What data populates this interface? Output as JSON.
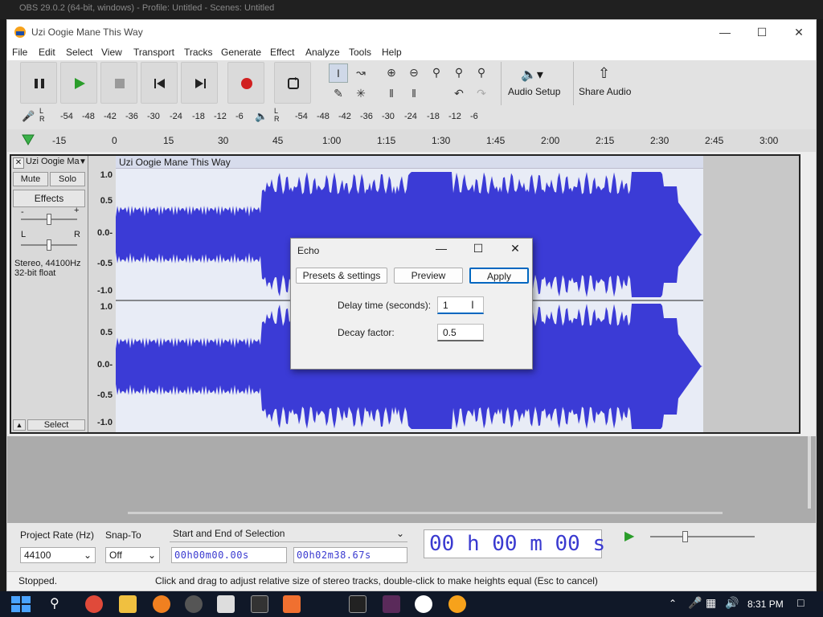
{
  "background_window": {
    "title": "OBS 29.0.2 (64-bit, windows) - Profile: Untitled - Scenes: Untitled"
  },
  "app": {
    "title": "Uzi Oogie Mane This Way",
    "menu": [
      "File",
      "Edit",
      "Select",
      "View",
      "Transport",
      "Tracks",
      "Generate",
      "Effect",
      "Analyze",
      "Tools",
      "Help"
    ],
    "audio_setup_label": "Audio Setup",
    "share_audio_label": "Share Audio",
    "meter_labels": [
      "-54",
      "-48",
      "-42",
      "-36",
      "-30",
      "-24",
      "-18",
      "-12",
      "-6"
    ],
    "timeline_ticks": [
      "-15",
      "0",
      "15",
      "30",
      "45",
      "1:00",
      "1:15",
      "1:30",
      "1:45",
      "2:00",
      "2:15",
      "2:30",
      "2:45",
      "3:00"
    ],
    "track": {
      "name": "Uzi Oogie Mane This Way",
      "short_name": "Uzi Oogie Ma",
      "mute_label": "Mute",
      "solo_label": "Solo",
      "effects_label": "Effects",
      "info_line1": "Stereo, 44100Hz",
      "info_line2": "32-bit float",
      "select_label": "Select",
      "gain_minus": "-",
      "gain_plus": "+",
      "pan_left": "L",
      "pan_right": "R",
      "ruler": [
        "1.0",
        "0.5",
        "0.0-",
        "-0.5",
        "-1.0",
        "1.0",
        "0.5",
        "0.0-",
        "-0.5",
        "-1.0"
      ]
    },
    "selection_toolbar": {
      "project_rate_label": "Project Rate (Hz)",
      "project_rate_value": "44100",
      "snap_to_label": "Snap-To",
      "snap_to_value": "Off",
      "selection_mode": "Start and End of Selection",
      "start_time": "00h00m00.00s",
      "end_time": "00h02m38.67s",
      "big_time": "00 h 00 m 00 s"
    },
    "status_left": "Stopped.",
    "status_message": "Click and drag to adjust relative size of stereo tracks, double-click to make heights equal (Esc to cancel)"
  },
  "dialog": {
    "title": "Echo",
    "presets_label": "Presets & settings",
    "preview_label": "Preview",
    "apply_label": "Apply",
    "delay_label": "Delay time (seconds):",
    "delay_value": "1",
    "decay_label": "Decay factor:",
    "decay_value": "0.5"
  },
  "taskbar": {
    "time": "8:31 PM"
  },
  "colors": {
    "waveform": "#3b3bd6",
    "selection_bg": "#e8ecf6",
    "accent": "#0067c0"
  }
}
